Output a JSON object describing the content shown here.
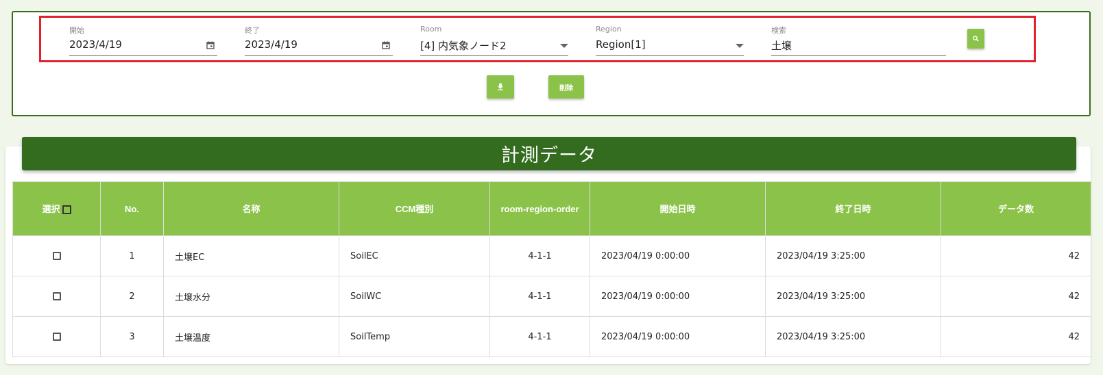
{
  "filters": {
    "start": {
      "label": "開始",
      "value": "2023/4/19"
    },
    "end": {
      "label": "終了",
      "value": "2023/4/19"
    },
    "room": {
      "label": "Room",
      "value": "[4] 内気象ノード2"
    },
    "region": {
      "label": "Region",
      "value": "Region[1]"
    },
    "search": {
      "label": "検索",
      "value": "土壌"
    }
  },
  "actions": {
    "delete_label": "削除"
  },
  "icons": {
    "search": "search-icon",
    "download": "download-icon",
    "calendar": "calendar-icon",
    "dropdown": "chevron-down-icon"
  },
  "section_title": "計測データ",
  "table": {
    "headers": {
      "select": "選択",
      "no": "No.",
      "name": "名称",
      "ccm_type": "CCM種別",
      "rro": "room-region-order",
      "start_time": "開始日時",
      "end_time": "終了日時",
      "count": "データ数"
    },
    "rows": [
      {
        "no": "1",
        "name": "土壌EC",
        "ccm_type": "SoilEC",
        "rro": "4-1-1",
        "start_time": "2023/04/19 0:00:00",
        "end_time": "2023/04/19 3:25:00",
        "count": "42"
      },
      {
        "no": "2",
        "name": "土壌水分",
        "ccm_type": "SoilWC",
        "rro": "4-1-1",
        "start_time": "2023/04/19 0:00:00",
        "end_time": "2023/04/19 3:25:00",
        "count": "42"
      },
      {
        "no": "3",
        "name": "土壌温度",
        "ccm_type": "SoilTemp",
        "rro": "4-1-1",
        "start_time": "2023/04/19 0:00:00",
        "end_time": "2023/04/19 3:25:00",
        "count": "42"
      }
    ]
  },
  "colors": {
    "accent_green": "#8bc34a",
    "dark_green": "#336b1f",
    "highlight_red": "#e3202c",
    "page_bg": "#f1f6ea"
  }
}
